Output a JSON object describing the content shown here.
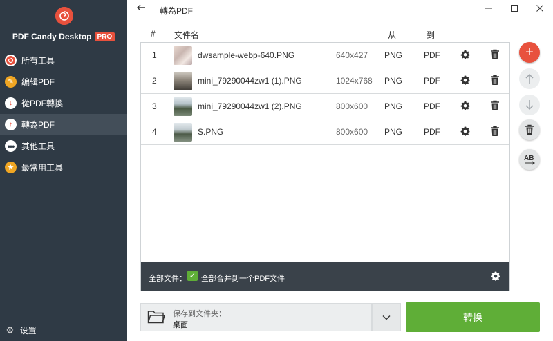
{
  "app": {
    "brand": "PDF Candy Desktop",
    "pro_badge": "PRO"
  },
  "sidebar": {
    "items": [
      {
        "label": "所有工具",
        "icon": "spiral-icon",
        "color": "#e8513d"
      },
      {
        "label": "编辑PDF",
        "icon": "pen-icon",
        "color": "#f0a623"
      },
      {
        "label": "從PDF轉換",
        "icon": "arrow-down-icon",
        "color": "#e8513d"
      },
      {
        "label": "轉為PDF",
        "icon": "arrow-up-icon",
        "color": "#e8513d",
        "active": true
      },
      {
        "label": "其他工具",
        "icon": "more-dots-icon",
        "color": "#ffffff"
      },
      {
        "label": "最常用工具",
        "icon": "star-icon",
        "color": "#f0a623"
      }
    ],
    "settings_label": "设置"
  },
  "header": {
    "title": "轉為PDF"
  },
  "table": {
    "columns": {
      "num": "#",
      "filename": "文件名",
      "from": "从",
      "to": "到"
    },
    "rows": [
      {
        "num": "1",
        "filename": "dwsample-webp-640.PNG",
        "size": "640x427",
        "from": "PNG",
        "to": "PDF"
      },
      {
        "num": "2",
        "filename": "mini_79290044zw1 (1).PNG",
        "size": "1024x768",
        "from": "PNG",
        "to": "PDF"
      },
      {
        "num": "3",
        "filename": "mini_79290044zw1 (2).PNG",
        "size": "800x600",
        "from": "PNG",
        "to": "PDF"
      },
      {
        "num": "4",
        "filename": "S.PNG",
        "size": "800x600",
        "from": "PNG",
        "to": "PDF"
      }
    ],
    "footer": {
      "all_files_label": "全部文件：",
      "merge_label": "全部合并到一个PDF文件",
      "merge_checked": true
    }
  },
  "bottom": {
    "save_label": "保存到文件夹：",
    "save_value": "桌面",
    "convert_label": "转换"
  },
  "colors": {
    "accent": "#e8513d",
    "convert": "#5fae37",
    "sidebar": "#2f3a45"
  }
}
